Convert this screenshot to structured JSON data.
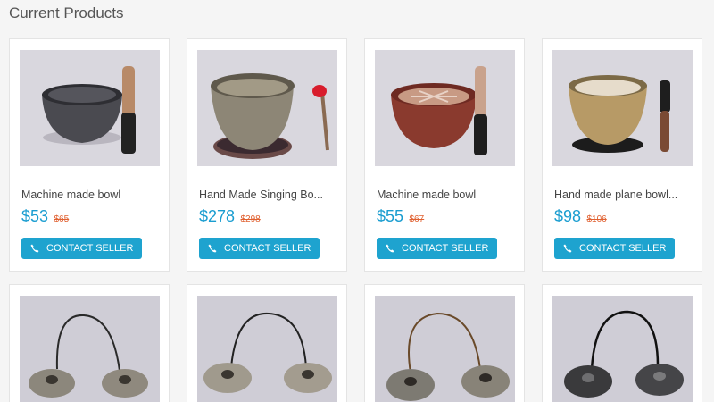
{
  "section": {
    "title": "Current Products"
  },
  "contact_label": "CONTACT SELLER",
  "products": [
    {
      "title": "Machine made bowl",
      "price": "$53",
      "old_price": "$65",
      "image": "dark-metal-bowl-with-mallet"
    },
    {
      "title": "Hand Made Singing Bo...",
      "price": "$278",
      "old_price": "$298",
      "image": "antique-bowl-with-red-striker"
    },
    {
      "title": "Machine made bowl",
      "price": "$55",
      "old_price": "$67",
      "image": "red-patterned-bowl-with-mallet"
    },
    {
      "title": "Hand made plane bowl...",
      "price": "$98",
      "old_price": "$106",
      "image": "polished-bowl-with-mallet"
    }
  ],
  "products_row2": [
    {
      "image": "tingsha-cymbals"
    },
    {
      "image": "tingsha-cymbals"
    },
    {
      "image": "tingsha-cymbals"
    },
    {
      "image": "tingsha-cymbals-dark"
    }
  ],
  "colors": {
    "accent": "#1ea3cf",
    "price": "#1a9dd0",
    "old_price": "#e06030"
  }
}
